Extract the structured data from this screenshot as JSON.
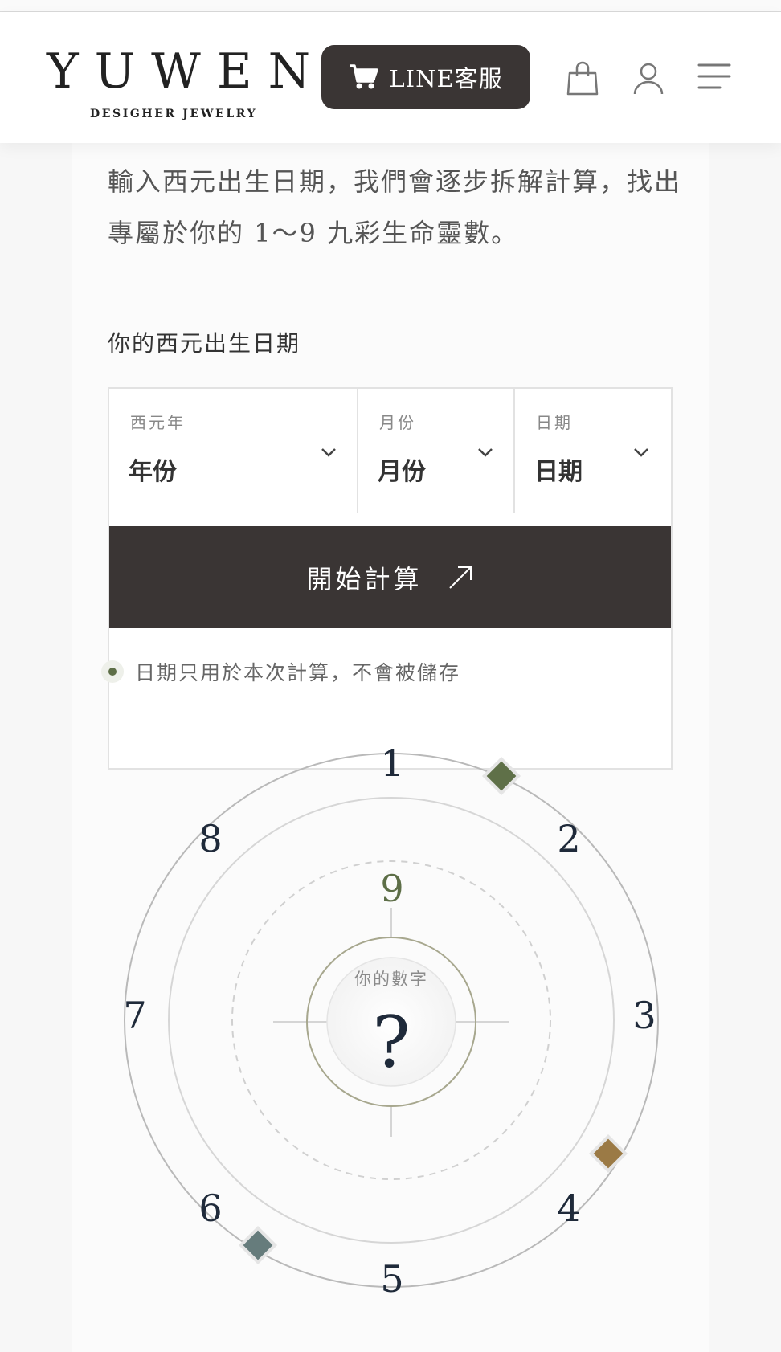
{
  "brand": {
    "name": "YUWEN",
    "tagline": "DESIGHER JEWELRY"
  },
  "header": {
    "line_button": "LINE客服",
    "icons": [
      "cart-icon",
      "shopping-bag-icon",
      "user-icon",
      "menu-icon"
    ]
  },
  "intro": {
    "text": "輸入西元出生日期，我們會逐步拆解計算，找出專屬於你的 1～9 九彩生命靈數。"
  },
  "form": {
    "label": "你的西元出生日期",
    "year": {
      "caption": "西元年",
      "value": "年份"
    },
    "month": {
      "caption": "月份",
      "value": "月份"
    },
    "day": {
      "caption": "日期",
      "value": "日期"
    },
    "submit": "開始計算",
    "note": "日期只用於本次計算，不會被儲存"
  },
  "wheel": {
    "center_label": "你的數字",
    "center_value": "?",
    "numbers": [
      "1",
      "2",
      "3",
      "4",
      "5",
      "6",
      "7",
      "8",
      "9"
    ],
    "diamond_colors": [
      "#5f7048",
      "#9b7a45",
      "#667c7c"
    ]
  },
  "colors": {
    "dark_button": "#3a3534",
    "accent_green": "#5d6e47",
    "accent_gold": "#9b7a45",
    "accent_teal": "#667c7c"
  }
}
